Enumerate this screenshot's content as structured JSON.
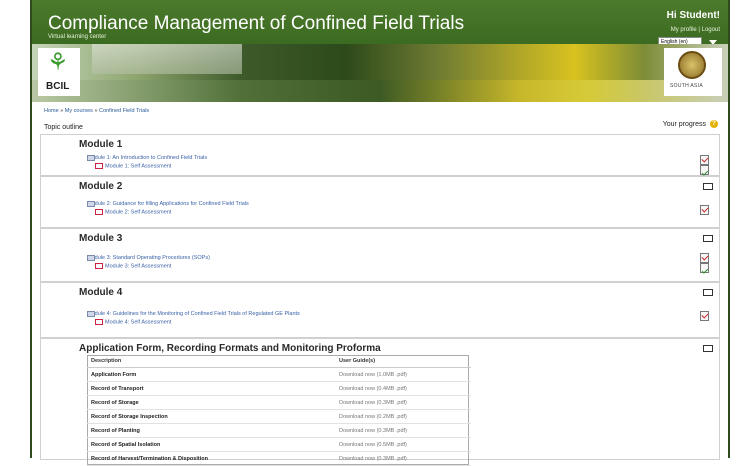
{
  "header": {
    "title": "Compliance Management of Confined Field Trials",
    "subtitle": "Virtual learning center",
    "greeting": "Hi Student!",
    "profile_links": "My profile | Logout",
    "language": "English (en)"
  },
  "logos": {
    "left_text": "BCIL",
    "right_text": "SOUTH ASIA"
  },
  "breadcrumb": {
    "home": "Home",
    "sep1": " » ",
    "courses": "My courses",
    "sep2": " » ",
    "current": "Confined Field Trials"
  },
  "topic_outline": "Topic outline",
  "progress_label": "Your progress",
  "help_glyph": "?",
  "modules": [
    {
      "title": "Module 1",
      "activity": "Module 1: An Introduction to Confined Field Trials",
      "quiz": "Module 1: Self Assessment"
    },
    {
      "title": "Module 2",
      "activity": "Module 2: Guidance for filling Applications for Confined Field Trials",
      "quiz": "Module 2: Self Assessment"
    },
    {
      "title": "Module 3",
      "activity": "Module 3: Standard Operating Procedures (SOPs)",
      "quiz": "Module 3: Self Assessment"
    },
    {
      "title": "Module 4",
      "activity": "Module 4: Guidelines for the Monitoring of Confined Field Trials of Regulated GE Plants",
      "quiz": "Module 4: Self Assessment"
    }
  ],
  "forms": {
    "title": "Application Form, Recording Formats and Monitoring Proforma",
    "col_desc": "Description",
    "col_guide": "User Guide(s)",
    "rows": [
      {
        "desc": "Application Form",
        "link": "Download now (1.0MB .pdf)"
      },
      {
        "desc": "Record of Transport",
        "link": "Download now (0.4MB .pdf)"
      },
      {
        "desc": "Record of Storage",
        "link": "Download now (0.3MB .pdf)"
      },
      {
        "desc": "Record of Storage Inspection",
        "link": "Download now (0.2MB .pdf)"
      },
      {
        "desc": "Record of Planting",
        "link": "Download now (0.3MB .pdf)"
      },
      {
        "desc": "Record of Spatial Isolation",
        "link": "Download now (0.5MB .pdf)"
      },
      {
        "desc": "Record of Harvest/Termination & Disposition",
        "link": "Download now (0.3MB .pdf)"
      }
    ]
  }
}
